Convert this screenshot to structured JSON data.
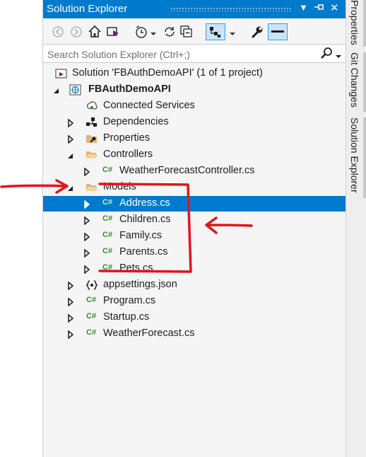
{
  "panel": {
    "title": "Solution Explorer",
    "search_placeholder": "Search Solution Explorer (Ctrl+;)"
  },
  "tree": [
    {
      "label": "Solution 'FBAuthDemoAPI' (1 of 1 project)",
      "icon": "solution-icon",
      "expander": "none"
    },
    {
      "label": "FBAuthDemoAPI",
      "icon": "web-project-icon",
      "expander": "expanded",
      "bold": true
    },
    {
      "label": "Connected Services",
      "icon": "connected-services-icon",
      "expander": "none"
    },
    {
      "label": "Dependencies",
      "icon": "dependencies-icon",
      "expander": "collapsed"
    },
    {
      "label": "Properties",
      "icon": "properties-wrench-icon",
      "expander": "collapsed"
    },
    {
      "label": "Controllers",
      "icon": "folder-open-icon",
      "expander": "expanded"
    },
    {
      "label": "WeatherForecastController.cs",
      "icon": "csharp-file-icon",
      "expander": "collapsed"
    },
    {
      "label": "Models",
      "icon": "folder-open-icon",
      "expander": "expanded"
    },
    {
      "label": "Address.cs",
      "icon": "csharp-file-icon",
      "expander": "collapsed",
      "selected": true
    },
    {
      "label": "Children.cs",
      "icon": "csharp-file-icon",
      "expander": "collapsed"
    },
    {
      "label": "Family.cs",
      "icon": "csharp-file-icon",
      "expander": "collapsed"
    },
    {
      "label": "Parents.cs",
      "icon": "csharp-file-icon",
      "expander": "collapsed"
    },
    {
      "label": "Pets.cs",
      "icon": "csharp-file-icon",
      "expander": "collapsed"
    },
    {
      "label": "appsettings.json",
      "icon": "json-settings-icon",
      "expander": "collapsed"
    },
    {
      "label": "Program.cs",
      "icon": "csharp-file-icon",
      "expander": "collapsed"
    },
    {
      "label": "Startup.cs",
      "icon": "csharp-file-icon",
      "expander": "collapsed"
    },
    {
      "label": "WeatherForecast.cs",
      "icon": "csharp-file-icon",
      "expander": "collapsed"
    }
  ],
  "side_tabs": {
    "properties": "Properties",
    "git_changes": "Git Changes",
    "solution_explorer": "Solution Explorer"
  },
  "glyphs": {
    "csharp": "C#"
  },
  "colors": {
    "accent": "#007acc",
    "annotation": "#e3141b"
  }
}
